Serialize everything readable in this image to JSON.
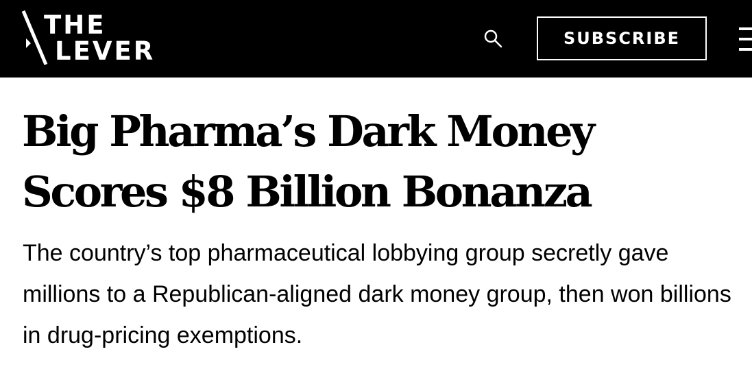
{
  "header": {
    "logo": {
      "line1": "THE",
      "line2": "LEVER"
    },
    "search_icon": "search-icon",
    "subscribe_label": "SUBSCRIBE",
    "menu_icon": "hamburger-menu-icon"
  },
  "article": {
    "headline": "Big Pharma’s Dark Money Scores $8 Billion Bonanza",
    "dek": "The country’s top pharmaceutical lobbying group secretly gave millions to a Republican-aligned dark money group, then won billions in drug-pricing exemptions."
  },
  "colors": {
    "header_background": "#000000",
    "header_foreground": "#ffffff",
    "page_background": "#ffffff",
    "text": "#000000"
  }
}
